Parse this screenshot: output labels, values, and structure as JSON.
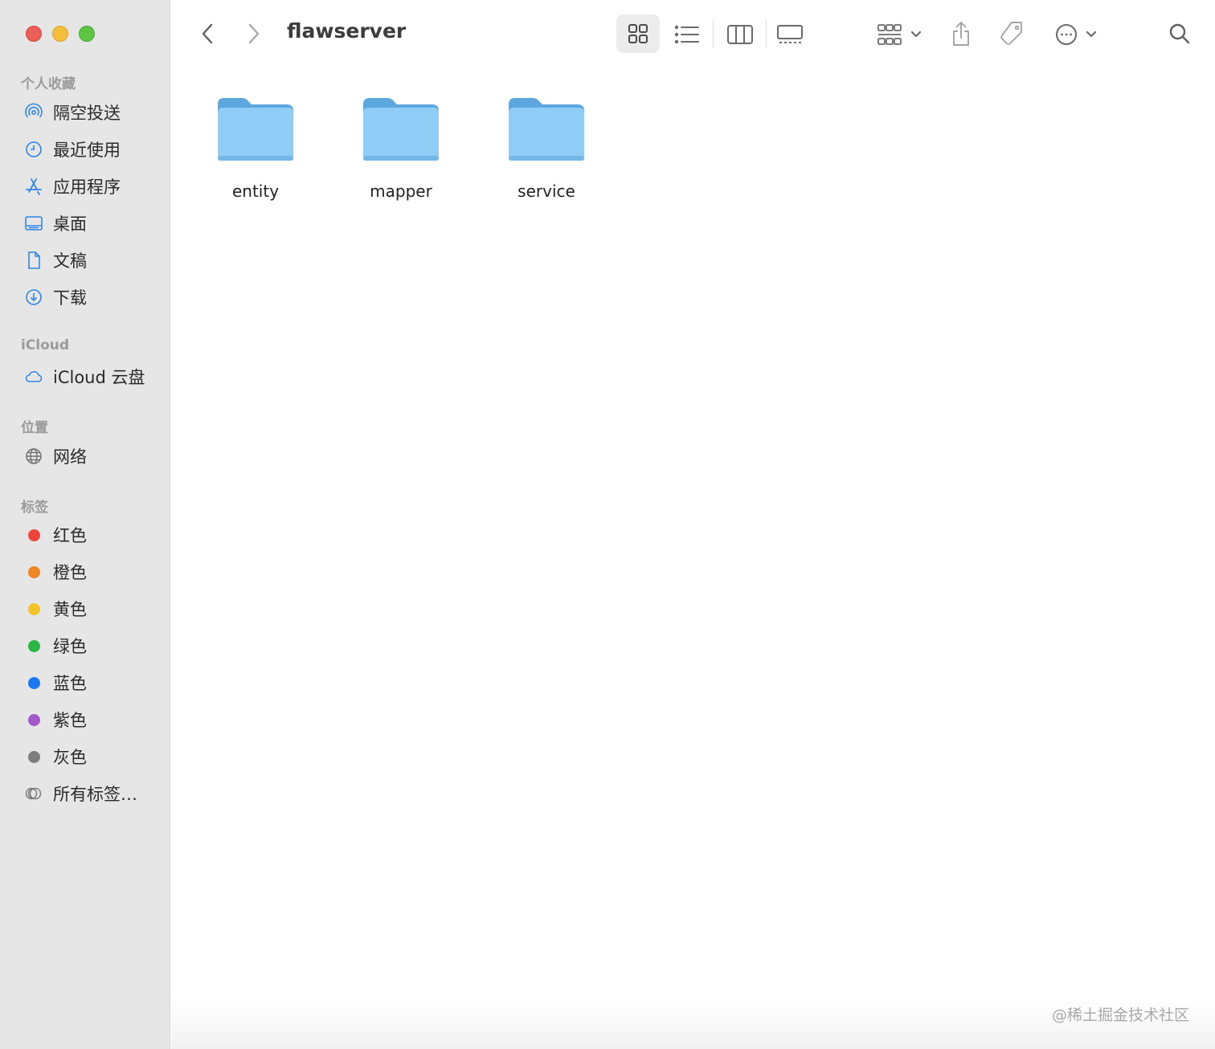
{
  "window": {
    "title": "flawserver"
  },
  "sidebar": {
    "sections": {
      "favorites": "个人收藏",
      "icloud": "iCloud",
      "locations": "位置",
      "tags": "标签"
    },
    "favorites": [
      {
        "label": "隔空投送",
        "icon": "airdrop-icon"
      },
      {
        "label": "最近使用",
        "icon": "clock-icon"
      },
      {
        "label": "应用程序",
        "icon": "applications-icon"
      },
      {
        "label": "桌面",
        "icon": "desktop-icon"
      },
      {
        "label": "文稿",
        "icon": "document-icon"
      },
      {
        "label": "下载",
        "icon": "download-icon"
      }
    ],
    "icloud": [
      {
        "label": "iCloud 云盘",
        "icon": "cloud-icon"
      }
    ],
    "locations": [
      {
        "label": "网络",
        "icon": "network-icon"
      }
    ],
    "tags": [
      {
        "label": "红色",
        "color": "#f0443a"
      },
      {
        "label": "橙色",
        "color": "#f08522"
      },
      {
        "label": "黄色",
        "color": "#f4c32a"
      },
      {
        "label": "绿色",
        "color": "#29b644"
      },
      {
        "label": "蓝色",
        "color": "#1a78f0"
      },
      {
        "label": "紫色",
        "color": "#a457c9"
      },
      {
        "label": "灰色",
        "color": "#7d7d7d"
      },
      {
        "label": "所有标签…",
        "icon": "all-tags-icon"
      }
    ]
  },
  "content": {
    "items": [
      {
        "name": "entity",
        "kind": "folder"
      },
      {
        "name": "mapper",
        "kind": "folder"
      },
      {
        "name": "service",
        "kind": "folder"
      }
    ]
  },
  "watermark": "@稀土掘金技术社区",
  "colors": {
    "folder_body": "#8fcdf7",
    "folder_tab": "#5ca7e0",
    "sidebar_bg": "#e6e6e6",
    "accent": "#2f86e6"
  }
}
